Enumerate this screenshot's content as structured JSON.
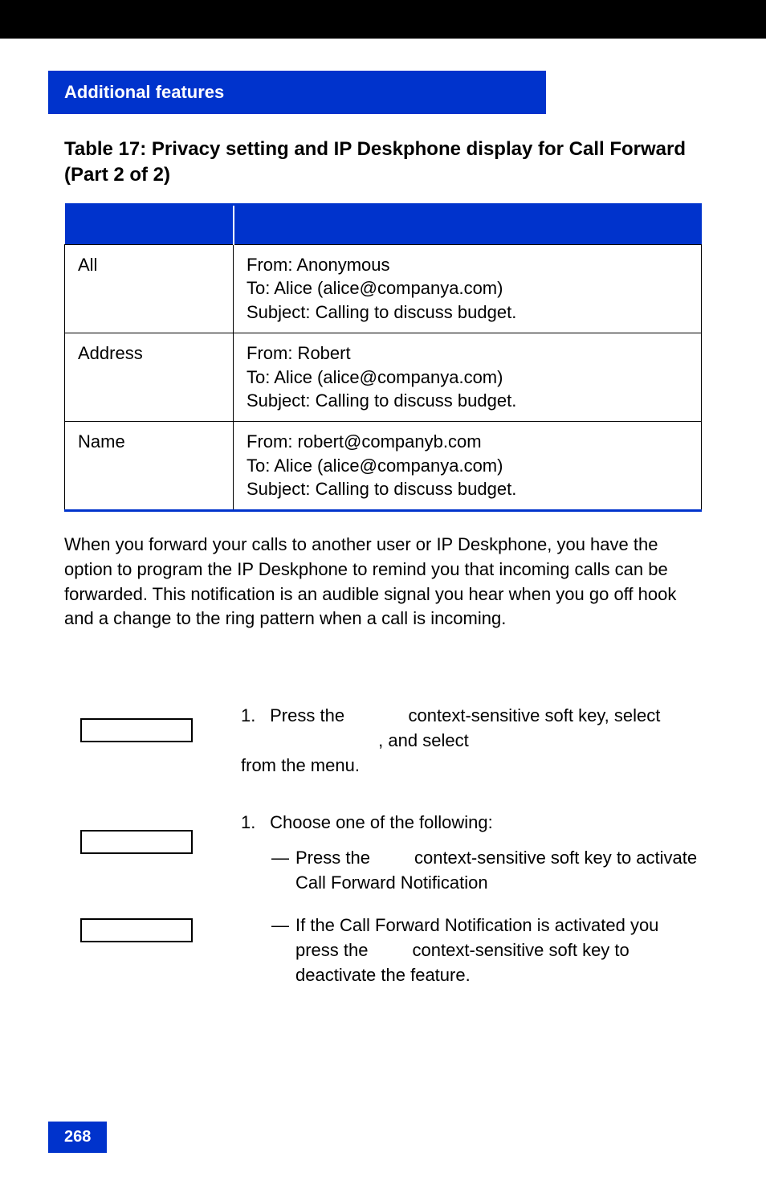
{
  "section_header": "Additional features",
  "table_title": "Table 17: Privacy setting and IP Deskphone display for Call Forward (Part 2 of 2)",
  "table": {
    "rows": [
      {
        "label": "All",
        "lines": [
          "From: Anonymous",
          "To: Alice (alice@companya.com)",
          "Subject: Calling to discuss budget."
        ]
      },
      {
        "label": "Address",
        "lines": [
          "From: Robert",
          "To: Alice (alice@companya.com)",
          "Subject: Calling to discuss budget."
        ]
      },
      {
        "label": "Name",
        "lines": [
          "From: robert@companyb.com",
          "To: Alice (alice@companya.com)",
          "Subject: Calling to discuss budget."
        ]
      }
    ]
  },
  "body_paragraph": "When you forward your calls to another user or IP Deskphone, you have the option to program the IP Deskphone to remind you that incoming calls can be forwarded. This notification is an audible signal you hear when you go off hook and a change to the ring pattern when a call is incoming.",
  "steps": {
    "step1": {
      "number": "1.",
      "text_parts": {
        "a": "Press the ",
        "b": " context-sensitive soft key, select ",
        "c": ", and select ",
        "d": " from the menu."
      }
    },
    "step2": {
      "number": "1.",
      "lead": "Choose one of the following:",
      "items": [
        {
          "dash": "—",
          "text_parts": {
            "a": "Press the ",
            "b": " context-sensitive soft key to activate Call Forward Notification"
          }
        },
        {
          "dash": "—",
          "text_parts": {
            "a": "If the Call Forward Notification is activated you press the ",
            "b": " context-sensitive soft key to deactivate the feature."
          }
        }
      ]
    }
  },
  "page_number": "268"
}
